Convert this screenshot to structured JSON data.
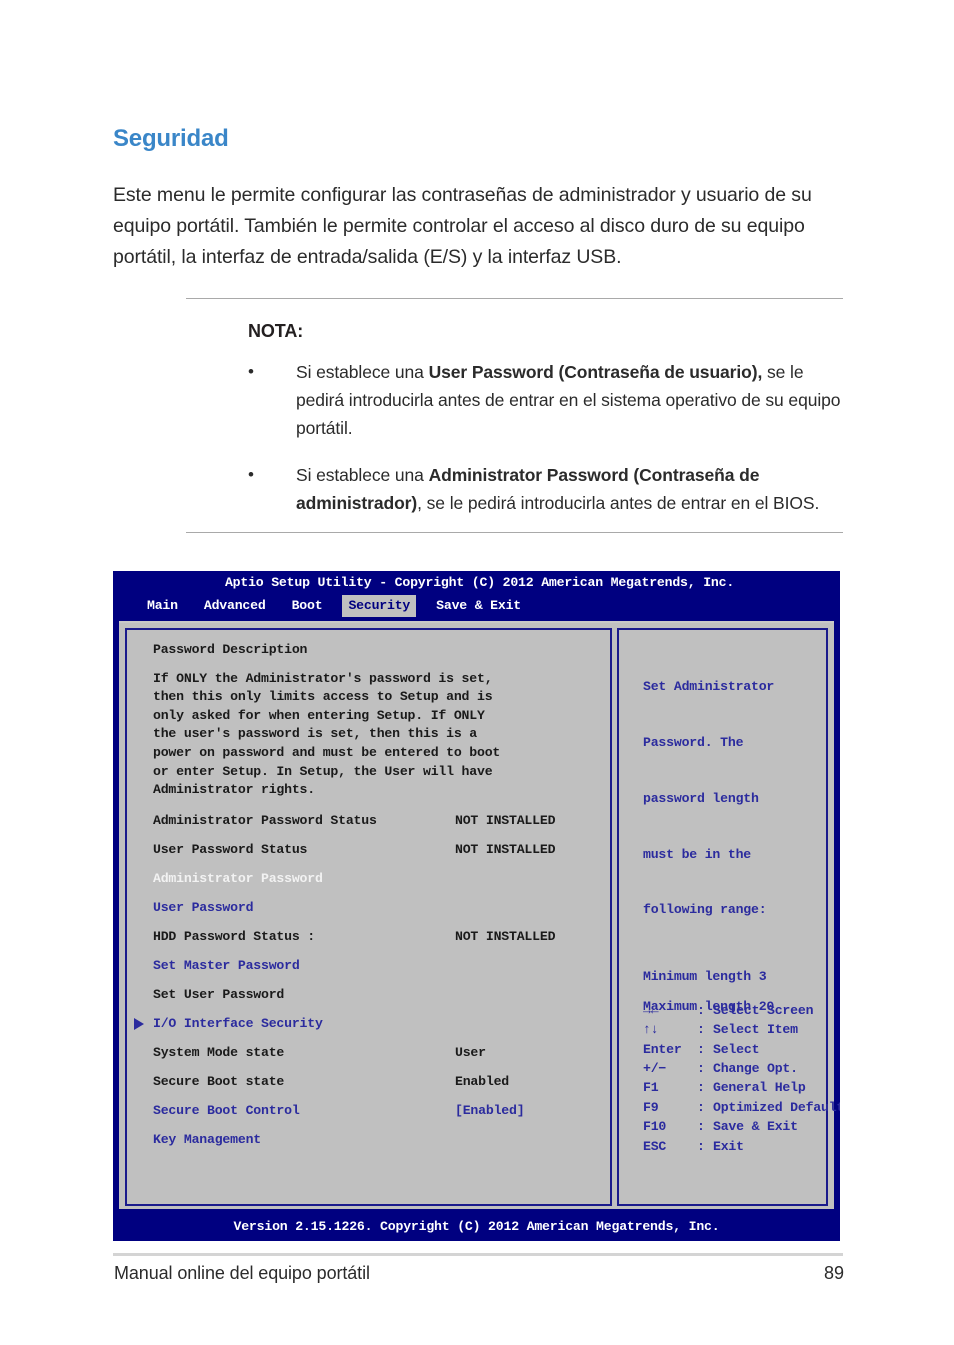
{
  "document": {
    "title": "Seguridad",
    "intro": "Este menu le permite configurar las contraseñas de administrador y usuario de su equipo portátil. También le permite controlar el acceso al disco duro de su equipo portátil, la interfaz de entrada/salida (E/S) y la interfaz USB.",
    "accent_color": "#3a86c8",
    "note": {
      "title": "NOTA:",
      "bullet_glyph": "•",
      "items": [
        {
          "prefix": "Si establece una ",
          "bold": "User Password (Contraseña de usuario),",
          "suffix": " se le pedirá introducirla antes de entrar en el sistema operativo de su equipo portátil."
        },
        {
          "prefix": "Si establece una ",
          "bold": "Administrator Password (Contraseña de administrador)",
          "suffix": ", se le pedirá introducirla antes de entrar en el BIOS."
        }
      ]
    }
  },
  "bios": {
    "title": "Aptio Setup Utility - Copyright (C) 2012 American Megatrends, Inc.",
    "version_footer": "Version 2.15.1226. Copyright (C) 2012 American Megatrends, Inc.",
    "colors": {
      "background": "#000080",
      "panel": "#c0c0c0",
      "border": "#1a1a8c",
      "text_dark": "#1a1a1a",
      "text_blue": "#2b2b9e",
      "text_white": "#f2f2f2",
      "tab_active_bg": "#c0c0c0"
    },
    "tabs": [
      {
        "label": "Main",
        "active": false
      },
      {
        "label": "Advanced",
        "active": false
      },
      {
        "label": "Boot",
        "active": false
      },
      {
        "label": "Security",
        "active": true
      },
      {
        "label": "Save & Exit",
        "active": false
      }
    ],
    "left_panel": {
      "heading": "Password Description",
      "description_lines": [
        "If ONLY the Administrator's password is set,",
        "then this only limits access to Setup and is",
        "only asked for when entering Setup. If ONLY",
        "the user's password is set, then this is a",
        "power on password and must be entered to boot",
        "or enter Setup. In Setup, the User will have",
        "Administrator rights."
      ],
      "rows": [
        {
          "label": "Administrator Password Status",
          "value": "NOT INSTALLED",
          "label_color": "dark",
          "value_color": "dark",
          "marker": false
        },
        {
          "label": "User Password Status",
          "value": "NOT INSTALLED",
          "label_color": "dark",
          "value_color": "dark",
          "marker": false
        },
        {
          "label": "Administrator Password",
          "value": "",
          "label_color": "white",
          "value_color": "white",
          "marker": false
        },
        {
          "label": "User Password",
          "value": "",
          "label_color": "blue",
          "value_color": "blue",
          "marker": false
        },
        {
          "label": "HDD Password Status :",
          "value": "NOT INSTALLED",
          "label_color": "dark",
          "value_color": "dark",
          "marker": false
        },
        {
          "label": "Set Master Password",
          "value": "",
          "label_color": "blue",
          "value_color": "blue",
          "marker": false
        },
        {
          "label": "Set User Password",
          "value": "",
          "label_color": "dark",
          "value_color": "dark",
          "marker": false
        },
        {
          "label": "I/O Interface Security",
          "value": "",
          "label_color": "blue",
          "value_color": "blue",
          "marker": true
        },
        {
          "label": "System Mode state",
          "value": "User",
          "label_color": "dark",
          "value_color": "dark",
          "marker": false
        },
        {
          "label": "Secure Boot state",
          "value": "Enabled",
          "label_color": "dark",
          "value_color": "dark",
          "marker": false
        },
        {
          "label": "Secure Boot Control",
          "value": "[Enabled]",
          "label_color": "blue",
          "value_color": "blue",
          "marker": false
        },
        {
          "label": "Key Management",
          "value": "",
          "label_color": "blue",
          "value_color": "blue",
          "marker": false
        }
      ]
    },
    "right_panel": {
      "help_lines": [
        "Set Administrator",
        "Password. The",
        "password length",
        "must be in the",
        "following range:"
      ],
      "help_extra": [
        "Minimum length 3",
        "Maximum length 20"
      ],
      "keys": [
        {
          "key": "→←",
          "sep": ":",
          "action": "Select Screen"
        },
        {
          "key": "↑↓",
          "sep": ":",
          "action": "Select Item"
        },
        {
          "key": "Enter",
          "sep": ":",
          "action": "Select"
        },
        {
          "key": "+/−",
          "sep": ":",
          "action": "Change Opt."
        },
        {
          "key": "F1",
          "sep": ":",
          "action": "General Help"
        },
        {
          "key": "F9",
          "sep": ":",
          "action": "Optimized Defaults"
        },
        {
          "key": "F10",
          "sep": ":",
          "action": "Save & Exit"
        },
        {
          "key": "ESC",
          "sep": ":",
          "action": "Exit"
        }
      ]
    }
  },
  "footer": {
    "text": "Manual online del equipo portátil",
    "page_number": "89"
  }
}
